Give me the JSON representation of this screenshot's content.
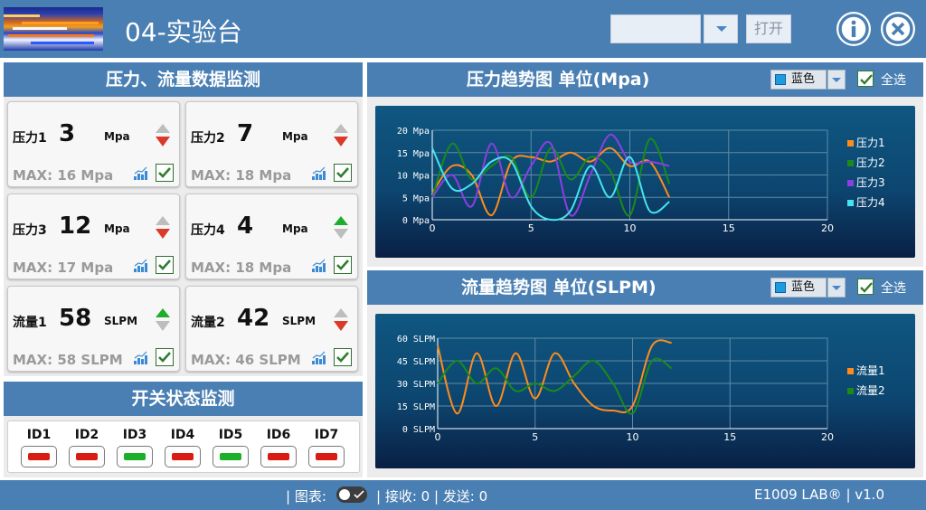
{
  "header": {
    "title": "04-实验台",
    "open_button": "打开",
    "port_value": ""
  },
  "panels": {
    "monitor_title": "压力、流量数据监测",
    "switch_title": "开关状态监测",
    "pressure_chart_title": "压力趋势图 单位(Mpa)",
    "flow_chart_title": "流量趋势图 单位(SLPM)",
    "color_label": "蓝色",
    "select_all_label": "全选"
  },
  "cards": [
    {
      "name": "压力1",
      "value": "3",
      "unit": "Mpa",
      "max": "MAX: 16 Mpa",
      "trend": "down"
    },
    {
      "name": "压力2",
      "value": "7",
      "unit": "Mpa",
      "max": "MAX: 18 Mpa",
      "trend": "down"
    },
    {
      "name": "压力3",
      "value": "12",
      "unit": "Mpa",
      "max": "MAX: 17 Mpa",
      "trend": "down"
    },
    {
      "name": "压力4",
      "value": "4",
      "unit": "Mpa",
      "max": "MAX: 18 Mpa",
      "trend": "up"
    },
    {
      "name": "流量1",
      "value": "58",
      "unit": "SLPM",
      "max": "MAX: 58 SLPM",
      "trend": "up"
    },
    {
      "name": "流量2",
      "value": "42",
      "unit": "SLPM",
      "max": "MAX: 46 SLPM",
      "trend": "down"
    }
  ],
  "switches": [
    {
      "id": "ID1",
      "state": "off"
    },
    {
      "id": "ID2",
      "state": "off"
    },
    {
      "id": "ID3",
      "state": "on"
    },
    {
      "id": "ID4",
      "state": "off"
    },
    {
      "id": "ID5",
      "state": "on"
    },
    {
      "id": "ID6",
      "state": "off"
    },
    {
      "id": "ID7",
      "state": "off"
    }
  ],
  "colors": {
    "header": "#4a7fb3",
    "switch_on": "#1fae2a",
    "switch_off": "#d91c12",
    "trend_up": "#1fae2a",
    "trend_down": "#d93a2a"
  },
  "footer": {
    "chart_label": "| 图表:",
    "stats": "| 接收: 0 | 发送: 0",
    "brand": "E1009 LAB® |  v1.0"
  },
  "chart_data": [
    {
      "type": "line",
      "xlim": [
        0,
        20
      ],
      "ylim": [
        0,
        20
      ],
      "x_ticks": [
        "0",
        "5",
        "10",
        "15",
        "20"
      ],
      "y_ticks": [
        "0 Mpa",
        "5 Mpa",
        "10 Mpa",
        "15 Mpa",
        "20 Mpa"
      ],
      "grid": true,
      "legend": "right",
      "series": [
        {
          "name": "压力1",
          "color": "#ff8c1a",
          "points": [
            [
              0,
              6
            ],
            [
              1,
              12
            ],
            [
              2,
              10
            ],
            [
              3,
              1
            ],
            [
              4,
              13
            ],
            [
              5,
              14
            ],
            [
              6,
              13
            ],
            [
              7,
              15
            ],
            [
              8,
              13
            ],
            [
              9,
              16
            ],
            [
              10,
              12
            ],
            [
              11,
              13
            ],
            [
              12,
              5
            ]
          ]
        },
        {
          "name": "压力2",
          "color": "#1b8a1b",
          "points": [
            [
              0,
              5
            ],
            [
              1,
              17
            ],
            [
              2,
              9
            ],
            [
              3,
              12
            ],
            [
              4,
              14
            ],
            [
              5,
              5
            ],
            [
              6,
              16
            ],
            [
              7,
              9
            ],
            [
              8,
              14
            ],
            [
              9,
              11
            ],
            [
              10,
              1
            ],
            [
              11,
              18
            ],
            [
              12,
              8
            ]
          ]
        },
        {
          "name": "压力3",
          "color": "#8b3fe0",
          "points": [
            [
              0,
              5
            ],
            [
              1,
              10
            ],
            [
              2,
              3
            ],
            [
              3,
              17
            ],
            [
              4,
              5
            ],
            [
              5,
              12
            ],
            [
              6,
              17
            ],
            [
              7,
              1
            ],
            [
              8,
              10
            ],
            [
              9,
              19
            ],
            [
              10,
              13
            ],
            [
              11,
              13
            ],
            [
              12,
              12
            ]
          ]
        },
        {
          "name": "压力4",
          "color": "#44e4ef",
          "points": [
            [
              0,
              16
            ],
            [
              1,
              7
            ],
            [
              2,
              8
            ],
            [
              3,
              13
            ],
            [
              4,
              13
            ],
            [
              5,
              3
            ],
            [
              6,
              0
            ],
            [
              7,
              2
            ],
            [
              8,
              12
            ],
            [
              9,
              5
            ],
            [
              10,
              14
            ],
            [
              11,
              2
            ],
            [
              12,
              4
            ]
          ]
        }
      ]
    },
    {
      "type": "line",
      "xlim": [
        0,
        20
      ],
      "ylim": [
        0,
        60
      ],
      "x_ticks": [
        "0",
        "5",
        "10",
        "15",
        "20"
      ],
      "y_ticks": [
        "0 SLPM",
        "15 SLPM",
        "30 SLPM",
        "45 SLPM",
        "60 SLPM"
      ],
      "grid": true,
      "legend": "right",
      "series": [
        {
          "name": "流量1",
          "color": "#ff8c1a",
          "points": [
            [
              0,
              55
            ],
            [
              1,
              10
            ],
            [
              2,
              50
            ],
            [
              3,
              15
            ],
            [
              4,
              50
            ],
            [
              5,
              20
            ],
            [
              6,
              50
            ],
            [
              7,
              30
            ],
            [
              8,
              15
            ],
            [
              9,
              12
            ],
            [
              10,
              15
            ],
            [
              11,
              55
            ],
            [
              12,
              57
            ]
          ]
        },
        {
          "name": "流量2",
          "color": "#1b8a1b",
          "points": [
            [
              0,
              30
            ],
            [
              1,
              45
            ],
            [
              2,
              30
            ],
            [
              3,
              40
            ],
            [
              4,
              25
            ],
            [
              5,
              30
            ],
            [
              6,
              25
            ],
            [
              7,
              35
            ],
            [
              8,
              45
            ],
            [
              9,
              30
            ],
            [
              10,
              10
            ],
            [
              11,
              45
            ],
            [
              12,
              40
            ]
          ]
        }
      ]
    }
  ]
}
